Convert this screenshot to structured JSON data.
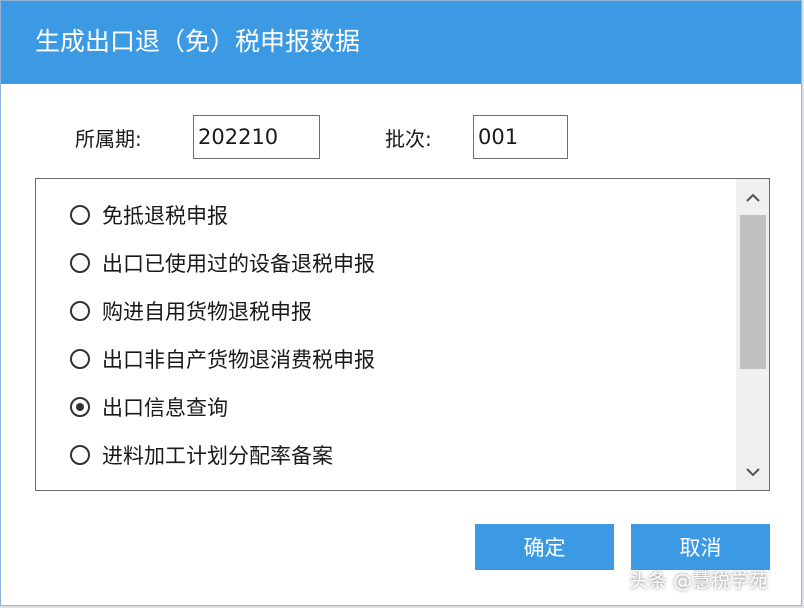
{
  "dialog": {
    "title": "生成出口退（免）税申报数据",
    "period_label": "所属期:",
    "period_value": "202210",
    "batch_label": "批次:",
    "batch_value": "001",
    "options": [
      {
        "label": "免抵退税申报",
        "selected": false
      },
      {
        "label": "出口已使用过的设备退税申报",
        "selected": false
      },
      {
        "label": "购进自用货物退税申报",
        "selected": false
      },
      {
        "label": "出口非自产货物退消费税申报",
        "selected": false
      },
      {
        "label": "出口信息查询",
        "selected": true
      },
      {
        "label": "进料加工计划分配率备案",
        "selected": false
      }
    ],
    "ok_label": "确定",
    "cancel_label": "取消"
  },
  "watermark": "头条 @慧税学苑",
  "colors": {
    "accent": "#3c9ae4",
    "window_bg": "#ffffff",
    "border": "#6b6b6b"
  }
}
